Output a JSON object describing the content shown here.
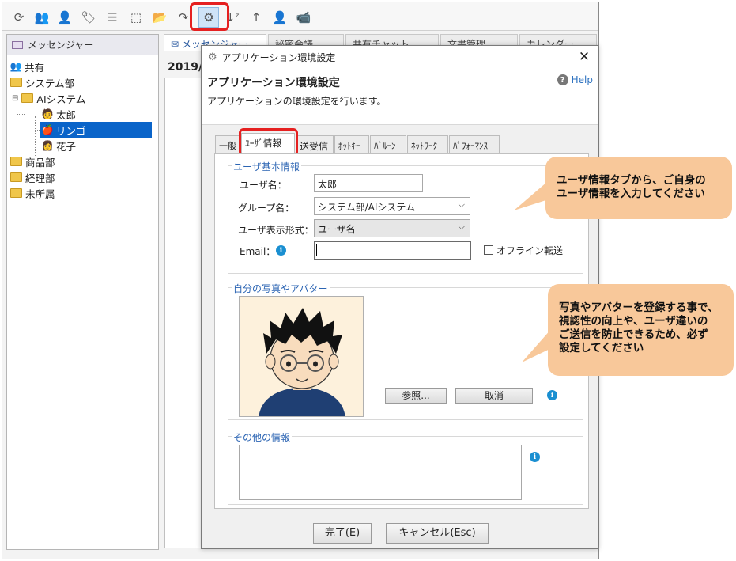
{
  "toolbar": {
    "icons": [
      "refresh-icon",
      "users-icon",
      "user-add-icon",
      "tag-icon",
      "select-all-icon",
      "select-icon",
      "folder-open-icon",
      "forward-icon",
      "settings-icon",
      "sort-az-icon",
      "sort-up-icon",
      "user-block-icon",
      "video-icon"
    ]
  },
  "tree": {
    "header": "メッセンジャー",
    "nodes": [
      {
        "label": "共有",
        "icon": "group-icon"
      },
      {
        "label": "システム部",
        "icon": "folder-icon"
      },
      {
        "label": "AIシステム",
        "icon": "folder-icon",
        "expander": "⊟"
      },
      {
        "label": "太郎",
        "icon": "person-male-icon"
      },
      {
        "label": "リンゴ",
        "icon": "apple-icon",
        "selected": true
      },
      {
        "label": "花子",
        "icon": "person-female-icon"
      },
      {
        "label": "商品部",
        "icon": "folder-icon"
      },
      {
        "label": "経理部",
        "icon": "folder-icon"
      },
      {
        "label": "未所属",
        "icon": "folder-icon"
      }
    ]
  },
  "background": {
    "tabs": [
      "メッセンジャー",
      "秘密会議",
      "共有チャット",
      "文書管理",
      "カレンダー"
    ],
    "date": "2019/"
  },
  "dialog": {
    "title": "アプリケーション環境設定",
    "heading": "アプリケーション環境設定",
    "description": "アプリケーションの環境設定を行います。",
    "help": "Help",
    "tabs": [
      "一般",
      "ﾕｰｻﾞ情報",
      "送受信",
      "ﾎｯﾄｷｰ",
      "ﾊﾞﾙｰﾝ",
      "ﾈｯﾄﾜｰｸ",
      "ﾊﾟﾌｫｰﾏﾝｽ"
    ],
    "basic_info": {
      "title": "ユーザ基本情報",
      "username_label": "ユーザ名：",
      "username_value": "太郎",
      "group_label": "グループ名：",
      "group_value": "システム部/AIシステム",
      "display_label": "ユーザ表示形式：",
      "display_value": "ユーザ名",
      "email_label": "Email：",
      "email_value": "",
      "offline_label": "オフライン転送"
    },
    "photo": {
      "title": "自分の写真やアバター",
      "browse": "参照...",
      "cancel": "取消"
    },
    "other": {
      "title": "その他の情報",
      "value": ""
    },
    "footer": {
      "ok": "完了(E)",
      "cancel": "キャンセル(Esc)"
    }
  },
  "callouts": {
    "tab_note": "ユーザ情報タブから、ご自身の\nユーザ情報を入力してください",
    "photo_note": "写真やアバターを登録する事で、\n視認性の向上や、ユーザ違いの\nご送信を防止できるため、必ず\n設定してください"
  },
  "colors": {
    "highlight": "#e52020",
    "callout": "#f8c89a",
    "selection": "#0a64c9",
    "link": "#2f73c0"
  }
}
